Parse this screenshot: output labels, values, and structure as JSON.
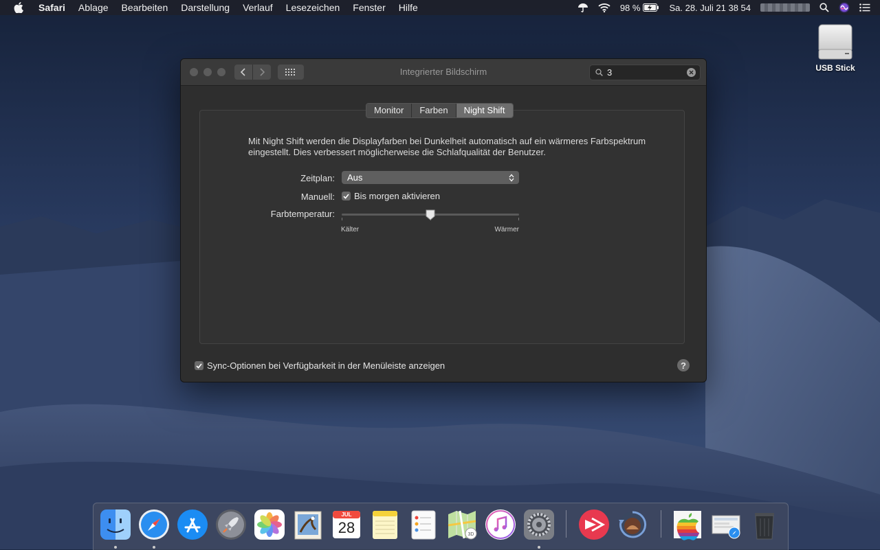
{
  "menubar": {
    "app_name": "Safari",
    "items": [
      "Ablage",
      "Bearbeiten",
      "Darstellung",
      "Verlauf",
      "Lesezeichen",
      "Fenster",
      "Hilfe"
    ],
    "battery": "98 %",
    "datetime": "Sa. 28. Juli  21 38 54"
  },
  "desktop": {
    "usb_label": "USB Stick"
  },
  "window": {
    "title": "Integrierter Bildschirm",
    "search_value": "3",
    "tabs": [
      "Monitor",
      "Farben",
      "Night Shift"
    ],
    "active_tab": "Night Shift",
    "description": "Mit Night Shift werden die Displayfarben bei Dunkelheit automatisch auf ein wärmeres Farbspektrum eingestellt. Dies verbessert möglicherweise die Schlafqualität der Benutzer.",
    "schedule_label": "Zeitplan:",
    "schedule_value": "Aus",
    "manual_label": "Manuell:",
    "manual_checkbox_label": "Bis morgen aktivieren",
    "manual_checked": true,
    "temperature_label": "Farbtemperatur:",
    "temperature_min_label": "Kälter",
    "temperature_max_label": "Wärmer",
    "temperature_level": 0.5,
    "sync_label": "Sync-Optionen bei Verfügbarkeit in der Menüleiste anzeigen",
    "sync_checked": true,
    "help_label": "?"
  },
  "dock": {
    "calendar_month": "JUL",
    "calendar_day": "28",
    "apps": [
      "finder",
      "safari",
      "app-store",
      "launchpad",
      "photos",
      "mail",
      "calendar",
      "notes",
      "reminders",
      "maps",
      "itunes",
      "system-preferences",
      "skitch",
      "time-machine",
      "rainbow-apple",
      "screenshot-folder",
      "trash"
    ]
  },
  "colors": {
    "window_bg": "#2e2e2e",
    "titlebar_bg": "#3a3a3a",
    "active_tab": "#6e6e6e",
    "desktop_sky": "#24365a"
  }
}
